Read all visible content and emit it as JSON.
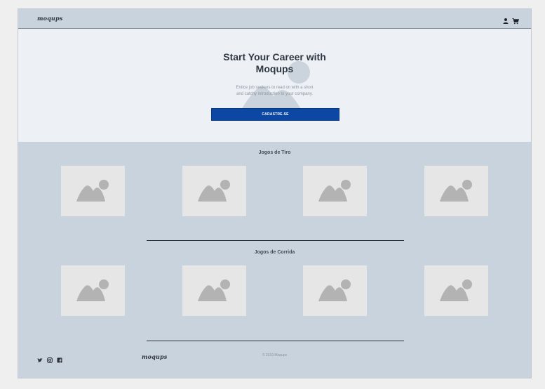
{
  "header": {
    "logo": "moqups",
    "icons": [
      "user-icon",
      "cart-icon"
    ]
  },
  "hero": {
    "title_line1": "Start Your Career with",
    "title_line2": "Moqups",
    "subtitle_line1": "Entice job seekers to read on with a short",
    "subtitle_line2": "and catchy introduction to your company.",
    "cta_label": "CADASTRE-SE"
  },
  "sections": [
    {
      "title": "Jogos de Tiro",
      "tiles": 4
    },
    {
      "title": "Jogos de Corrida",
      "tiles": 4
    }
  ],
  "footer": {
    "social_icons": [
      "twitter-icon",
      "instagram-icon",
      "facebook-icon"
    ],
    "logo": "moqups",
    "copyright": "© 2019 Moqups"
  },
  "colors": {
    "page_bg": "#c9d3de",
    "hero_bg": "#edf1f6",
    "cta": "#0b47a3",
    "placeholder_tile": "#e6e6e6",
    "placeholder_icon": "#b3b3b3"
  }
}
